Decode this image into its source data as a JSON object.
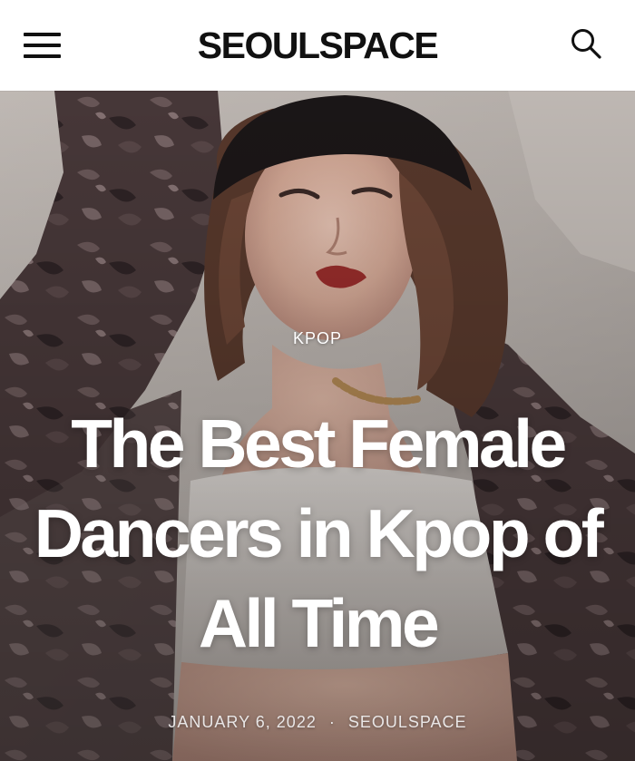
{
  "header": {
    "logo": "SEOULSPACE",
    "menu_icon": "hamburger-menu-icon",
    "search_icon": "search-icon"
  },
  "hero": {
    "category": "KPOP",
    "title": "The Best Female Dancers in Kpop of All Time",
    "date": "JANUARY 6, 2022",
    "separator": "·",
    "author": "SEOULSPACE"
  },
  "colors": {
    "header_bg": "#ffffff",
    "logo_text": "#111111",
    "hero_text": "#ffffff",
    "meta_text": "#e9e6e6"
  }
}
